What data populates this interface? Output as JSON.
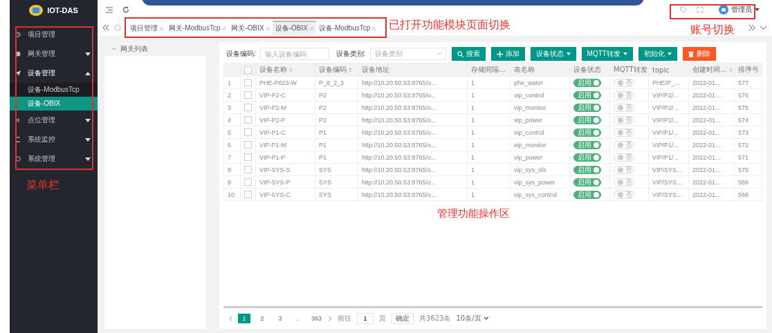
{
  "app": {
    "logo_text": "IOT-DAS"
  },
  "sidebar": {
    "items": [
      {
        "label": "项目管理",
        "selected": false
      },
      {
        "label": "网关管理",
        "selected": false,
        "expanded": false
      },
      {
        "label": "设备管理",
        "selected": false,
        "expanded": true,
        "children": [
          {
            "label": "设备-ModbusTcp",
            "selected": false
          },
          {
            "label": "设备-OBIX",
            "selected": true
          }
        ]
      },
      {
        "label": "点位管理",
        "selected": false,
        "expanded": false
      },
      {
        "label": "系统监控",
        "selected": false,
        "expanded": false
      },
      {
        "label": "系统管理",
        "selected": false,
        "expanded": false
      }
    ]
  },
  "header": {
    "account": {
      "name": "管理员"
    }
  },
  "tabs": [
    {
      "label": "项目管理",
      "selected": false
    },
    {
      "label": "网关-ModbusTcp",
      "selected": false
    },
    {
      "label": "网关-OBIX",
      "selected": false
    },
    {
      "label": "设备-OBIX",
      "selected": true
    },
    {
      "label": "设备-ModbusTcp",
      "selected": false
    }
  ],
  "tree": {
    "title": "网关列表",
    "expanded": true
  },
  "filters": [
    {
      "kind": "input",
      "label": "设备编码:",
      "placeholder": "输入设备编码"
    },
    {
      "kind": "select",
      "label": "设备类别:",
      "placeholder": "设备类别"
    }
  ],
  "actions": [
    {
      "kind": "search",
      "label": "搜索"
    },
    {
      "kind": "add",
      "label": "添加"
    },
    {
      "kind": "dropdown",
      "label": "设备状态"
    },
    {
      "kind": "dropdown",
      "label": "MQTT转发"
    },
    {
      "kind": "dropdown",
      "label": "初始化"
    },
    {
      "kind": "danger",
      "label": "删除"
    }
  ],
  "table": {
    "all_checked": false,
    "columns": [
      {
        "label": "设备名称",
        "sortable": true
      },
      {
        "label": "设备编码",
        "sortable": true
      },
      {
        "label": "设备地址",
        "sortable": false
      },
      {
        "label": "存储间隔...",
        "sortable": false
      },
      {
        "label": "表名称",
        "sortable": false
      },
      {
        "label": "设备状态",
        "sortable": false
      },
      {
        "label": "MQTT转发",
        "sortable": false
      },
      {
        "label": "topic",
        "sortable": false
      },
      {
        "label": "创建时间...",
        "sortable": true
      },
      {
        "label": "排序号",
        "sortable": false
      }
    ],
    "rows": [
      {
        "index": "1",
        "checked": false,
        "name": "PHE-P823-W",
        "code": "P_8_2_3",
        "address": "http://10.20.50.53:8765/o...",
        "interval": "1",
        "table_name": "phe_water",
        "enabled": true,
        "status_label": "启用",
        "mqtt": false,
        "mqtt_label": "否",
        "topic": "PHE/P_...",
        "created": "2022-01...",
        "sort": "577"
      },
      {
        "index": "2",
        "checked": false,
        "name": "VIP-P2-C",
        "code": "P2",
        "address": "http://10.20.50.53:8765/o...",
        "interval": "1",
        "table_name": "vip_control",
        "enabled": true,
        "status_label": "启用",
        "mqtt": false,
        "mqtt_label": "否",
        "topic": "VIP/P2/...",
        "created": "2022-01...",
        "sort": "576"
      },
      {
        "index": "3",
        "checked": false,
        "name": "VIP-P2-M",
        "code": "P2",
        "address": "http://10.20.50.53:8765/o...",
        "interval": "1",
        "table_name": "vip_monitor",
        "enabled": true,
        "status_label": "启用",
        "mqtt": false,
        "mqtt_label": "否",
        "topic": "VIP/P2/...",
        "created": "2022-01...",
        "sort": "575"
      },
      {
        "index": "4",
        "checked": false,
        "name": "VIP-P2-P",
        "code": "P2",
        "address": "http://10.20.50.53:8765/o...",
        "interval": "1",
        "table_name": "vip_power",
        "enabled": true,
        "status_label": "启用",
        "mqtt": false,
        "mqtt_label": "否",
        "topic": "VIP/P2/...",
        "created": "2022-01...",
        "sort": "574"
      },
      {
        "index": "5",
        "checked": false,
        "name": "VIP-P1-C",
        "code": "P1",
        "address": "http://10.20.50.53:8765/o...",
        "interval": "1",
        "table_name": "vip_control",
        "enabled": true,
        "status_label": "启用",
        "mqtt": false,
        "mqtt_label": "否",
        "topic": "VIP/P1/...",
        "created": "2022-01...",
        "sort": "573"
      },
      {
        "index": "6",
        "checked": false,
        "name": "VIP-P1-M",
        "code": "P1",
        "address": "http://10.20.50.53:8765/o...",
        "interval": "1",
        "table_name": "vip_monitor",
        "enabled": true,
        "status_label": "启用",
        "mqtt": false,
        "mqtt_label": "否",
        "topic": "VIP/P1/...",
        "created": "2022-01...",
        "sort": "572"
      },
      {
        "index": "7",
        "checked": false,
        "name": "VIP-P1-P",
        "code": "P1",
        "address": "http://10.20.50.53:8765/o...",
        "interval": "1",
        "table_name": "vip_power",
        "enabled": true,
        "status_label": "启用",
        "mqtt": false,
        "mqtt_label": "否",
        "topic": "VIP/P1/...",
        "created": "2022-01...",
        "sort": "571"
      },
      {
        "index": "8",
        "checked": false,
        "name": "VIP-SYS-S",
        "code": "SYS",
        "address": "http://10.20.50.53:8765/o...",
        "interval": "1",
        "table_name": "vip_sys_sfs",
        "enabled": true,
        "status_label": "启用",
        "mqtt": false,
        "mqtt_label": "否",
        "topic": "VIP/SYS...",
        "created": "2022-01...",
        "sort": "570"
      },
      {
        "index": "9",
        "checked": false,
        "name": "VIP-SYS-P",
        "code": "SYS",
        "address": "http://10.20.50.53:8765/o...",
        "interval": "1",
        "table_name": "vip_sys_power",
        "enabled": true,
        "status_label": "启用",
        "mqtt": false,
        "mqtt_label": "否",
        "topic": "VIP/SYS...",
        "created": "2022-01...",
        "sort": "569"
      },
      {
        "index": "10",
        "checked": false,
        "name": "VIP-SYS-C",
        "code": "SYS",
        "address": "http://10.20.50.53:8765/o...",
        "interval": "1",
        "table_name": "vip_sys_control",
        "enabled": true,
        "status_label": "启用",
        "mqtt": false,
        "mqtt_label": "否",
        "topic": "VIP/SYS...",
        "created": "2022-01...",
        "sort": "568"
      }
    ]
  },
  "pagination": {
    "pages": [
      {
        "kind": "page",
        "label": "1",
        "selected": true
      },
      {
        "kind": "page",
        "label": "2",
        "selected": false
      },
      {
        "kind": "page",
        "label": "3",
        "selected": false
      },
      {
        "kind": "more",
        "label": "...",
        "selected": false
      },
      {
        "kind": "page",
        "label": "363",
        "selected": false
      }
    ],
    "goto_label": "前往",
    "page_input": "1",
    "page_unit": "页",
    "confirm": "确定",
    "total": "共3623条",
    "page_size": "10条/页"
  },
  "annotations": [
    {
      "kind": "tabs",
      "text": "已打开功能模块页面切换"
    },
    {
      "kind": "account",
      "text": "账号切换"
    },
    {
      "kind": "menu",
      "text": "菜单栏"
    },
    {
      "kind": "workspace",
      "text": "管理功能操作区"
    }
  ]
}
